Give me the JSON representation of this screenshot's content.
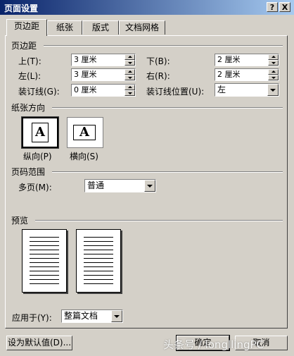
{
  "window": {
    "title": "页面设置",
    "help_label": "?",
    "close_label": "X",
    "title_bar_color": "#0a246a"
  },
  "tabs": [
    {
      "label": "页边距",
      "active": true
    },
    {
      "label": "纸张"
    },
    {
      "label": "版式"
    },
    {
      "label": "文档网格"
    }
  ],
  "margins": {
    "group_label": "页边距",
    "top_label": "上(T):",
    "top_value": "3 厘米",
    "bottom_label": "下(B):",
    "bottom_value": "2 厘米",
    "left_label": "左(L):",
    "left_value": "3 厘米",
    "right_label": "右(R):",
    "right_value": "2 厘米",
    "gutter_label": "装订线(G):",
    "gutter_value": "0 厘米",
    "gutter_pos_label": "装订线位置(U):",
    "gutter_pos_value": "左"
  },
  "orientation": {
    "group_label": "纸张方向",
    "portrait_label": "纵向(P)",
    "landscape_label": "横向(S)",
    "icon_letter": "A",
    "selected": "portrait"
  },
  "pages": {
    "group_label": "页码范围",
    "multiple_label": "多页(M):",
    "multiple_value": "普通"
  },
  "preview": {
    "group_label": "预览",
    "apply_label": "应用于(Y):",
    "apply_value": "整篇文档"
  },
  "footer": {
    "default_button": "设为默认值(D)...",
    "ok_button": "确定",
    "cancel_button": "取消"
  },
  "watermark": "头条号 / longllingPC"
}
